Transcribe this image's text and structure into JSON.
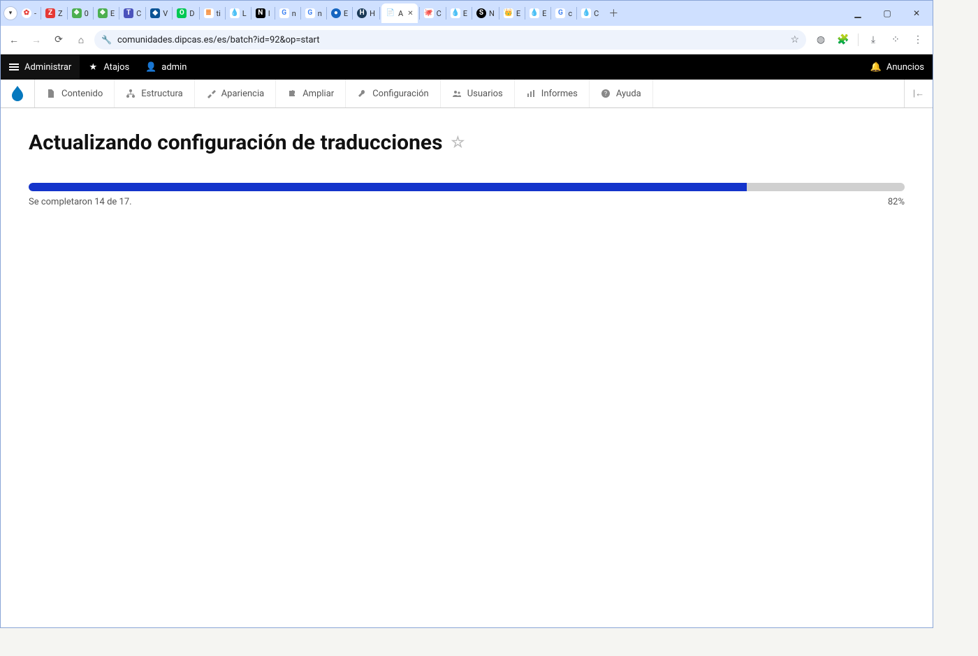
{
  "browser": {
    "url": "comunidades.dipcas.es/es/batch?id=92&op=start",
    "tabs": [
      {
        "label": "-",
        "favicon_bg": "#fff",
        "favicon_color": "#e53935",
        "favicon_text": "✿",
        "round": true
      },
      {
        "label": "Z",
        "favicon_bg": "#e53935",
        "favicon_color": "#fff",
        "favicon_text": "Z"
      },
      {
        "label": "0",
        "favicon_bg": "#4caf50",
        "favicon_color": "#fff",
        "favicon_text": "❖"
      },
      {
        "label": "E",
        "favicon_bg": "#4caf50",
        "favicon_color": "#fff",
        "favicon_text": "❖"
      },
      {
        "label": "C",
        "favicon_bg": "#4b53bc",
        "favicon_color": "#fff",
        "favicon_text": "T"
      },
      {
        "label": "V",
        "favicon_bg": "#0b5394",
        "favicon_color": "#fff",
        "favicon_text": "◆"
      },
      {
        "label": "D",
        "favicon_bg": "#00c853",
        "favicon_color": "#fff",
        "favicon_text": "O"
      },
      {
        "label": "ti",
        "favicon_bg": "#fff",
        "favicon_color": "#f48024",
        "favicon_text": "≣"
      },
      {
        "label": "L",
        "favicon_bg": "#fff",
        "favicon_color": "#0678be",
        "favicon_text": "💧"
      },
      {
        "label": "I",
        "favicon_bg": "#000",
        "favicon_color": "#fff",
        "favicon_text": "N"
      },
      {
        "label": "n",
        "favicon_bg": "#fff",
        "favicon_color": "#4285f4",
        "favicon_text": "G"
      },
      {
        "label": "n",
        "favicon_bg": "#fff",
        "favicon_color": "#4285f4",
        "favicon_text": "G"
      },
      {
        "label": "E",
        "favicon_bg": "#1565c0",
        "favicon_color": "#fff",
        "favicon_text": "●",
        "round": true
      },
      {
        "label": "H",
        "favicon_bg": "#1b3a57",
        "favicon_color": "#fff",
        "favicon_text": "H",
        "round": true
      },
      {
        "label": "A",
        "favicon_bg": "#fff",
        "favicon_color": "#555",
        "favicon_text": "📄",
        "active": true
      },
      {
        "label": "C",
        "favicon_bg": "#fff",
        "favicon_color": "#000",
        "favicon_text": "🐙"
      },
      {
        "label": "E",
        "favicon_bg": "#fff",
        "favicon_color": "#0678be",
        "favicon_text": "💧"
      },
      {
        "label": "N",
        "favicon_bg": "#000",
        "favicon_color": "#fff",
        "favicon_text": "S",
        "round": true
      },
      {
        "label": "E",
        "favicon_bg": "#fff",
        "favicon_color": "#b08b57",
        "favicon_text": "👑"
      },
      {
        "label": "E",
        "favicon_bg": "#fff",
        "favicon_color": "#0678be",
        "favicon_text": "💧"
      },
      {
        "label": "c",
        "favicon_bg": "#fff",
        "favicon_color": "#4285f4",
        "favicon_text": "G"
      },
      {
        "label": "C",
        "favicon_bg": "#fff",
        "favicon_color": "#0678be",
        "favicon_text": "💧"
      }
    ]
  },
  "adminbar": {
    "manage": "Administrar",
    "shortcuts": "Atajos",
    "user": "admin",
    "announcements": "Anuncios"
  },
  "secondary": [
    {
      "icon": "file",
      "label": "Contenido"
    },
    {
      "icon": "sitemap",
      "label": "Estructura"
    },
    {
      "icon": "brush",
      "label": "Apariencia"
    },
    {
      "icon": "puzzle",
      "label": "Ampliar"
    },
    {
      "icon": "wrench",
      "label": "Configuración"
    },
    {
      "icon": "users",
      "label": "Usuarios"
    },
    {
      "icon": "chart",
      "label": "Informes"
    },
    {
      "icon": "help",
      "label": "Ayuda"
    }
  ],
  "page": {
    "title": "Actualizando configuración de traducciones",
    "progress_message": "Se completaron 14 de 17.",
    "progress_percent_label": "82%",
    "progress_percent": 82
  }
}
